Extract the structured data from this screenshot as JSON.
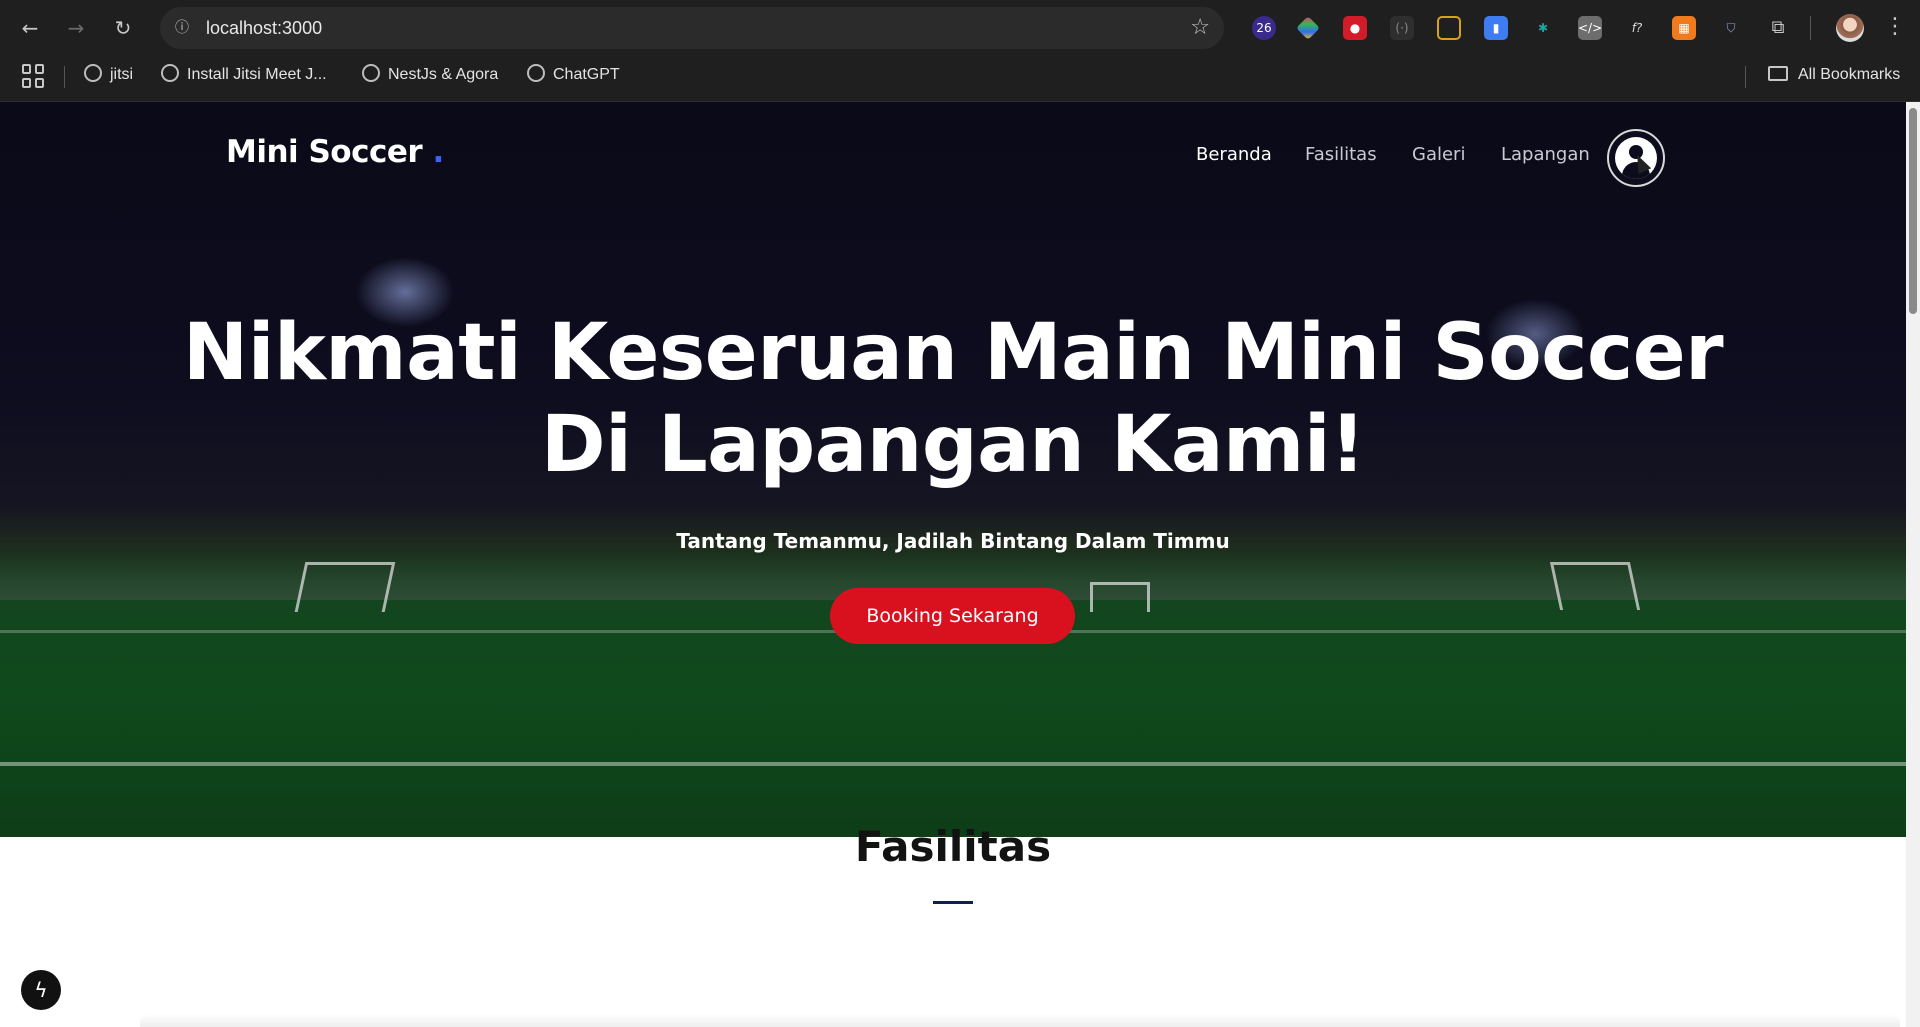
{
  "browser": {
    "url": "localhost:3000",
    "icons": {
      "back": "back-arrow-icon",
      "forward": "forward-arrow-icon",
      "reload": "reload-icon",
      "site_info": "site-info-icon",
      "bookmark_star": "star-icon",
      "menu": "kebab-menu-icon"
    },
    "extensions": [
      {
        "name": "ext-badge-26",
        "badge": "26",
        "color": "#3a2a8c"
      },
      {
        "name": "ext-color-diamond",
        "color": "#e0397a"
      },
      {
        "name": "ext-red-record",
        "color": "#d21c2a"
      },
      {
        "name": "ext-dark-bracket",
        "color": "#3a3a3a"
      },
      {
        "name": "ext-yellow-frame",
        "color": "#d6a21b"
      },
      {
        "name": "ext-blue-doc",
        "color": "#3d7cf1"
      },
      {
        "name": "ext-teal-gear",
        "color": "#1ba7a2"
      },
      {
        "name": "ext-code",
        "color": "#6d6d6d"
      },
      {
        "name": "ext-function",
        "badge": "f?",
        "color": "#1f1f1f"
      },
      {
        "name": "ext-orange-grid",
        "color": "#f07b1d"
      },
      {
        "name": "ext-shield",
        "color": "#5a6ea0"
      },
      {
        "name": "ext-puzzle",
        "color": "#1f1f1f"
      }
    ],
    "bookmarks": [
      {
        "label": "jitsi"
      },
      {
        "label": "Install Jitsi Meet J..."
      },
      {
        "label": "NestJs & Agora"
      },
      {
        "label": "ChatGPT"
      }
    ],
    "all_bookmarks": "All Bookmarks"
  },
  "site": {
    "brand": "Mini Soccer",
    "brand_dot": ".",
    "nav": {
      "items": [
        {
          "label": "Beranda",
          "active": true
        },
        {
          "label": "Fasilitas"
        },
        {
          "label": "Galeri"
        },
        {
          "label": "Lapangan"
        }
      ],
      "user_icon": "user-avatar-icon"
    },
    "hero": {
      "title_line1": "Nikmati Keseruan Main Mini Soccer",
      "title_line2": "Di Lapangan Kami!",
      "subtitle": "Tantang Temanmu, Jadilah Bintang Dalam Timmu",
      "cta": "Booking Sekarang",
      "cta_color": "#d9111f"
    },
    "section": {
      "title": "Fasilitas"
    }
  },
  "colors": {
    "brand_accent": "#3b63f5",
    "hero_dark": "#0d0c1c",
    "pitch_green": "#0f4a1c"
  }
}
